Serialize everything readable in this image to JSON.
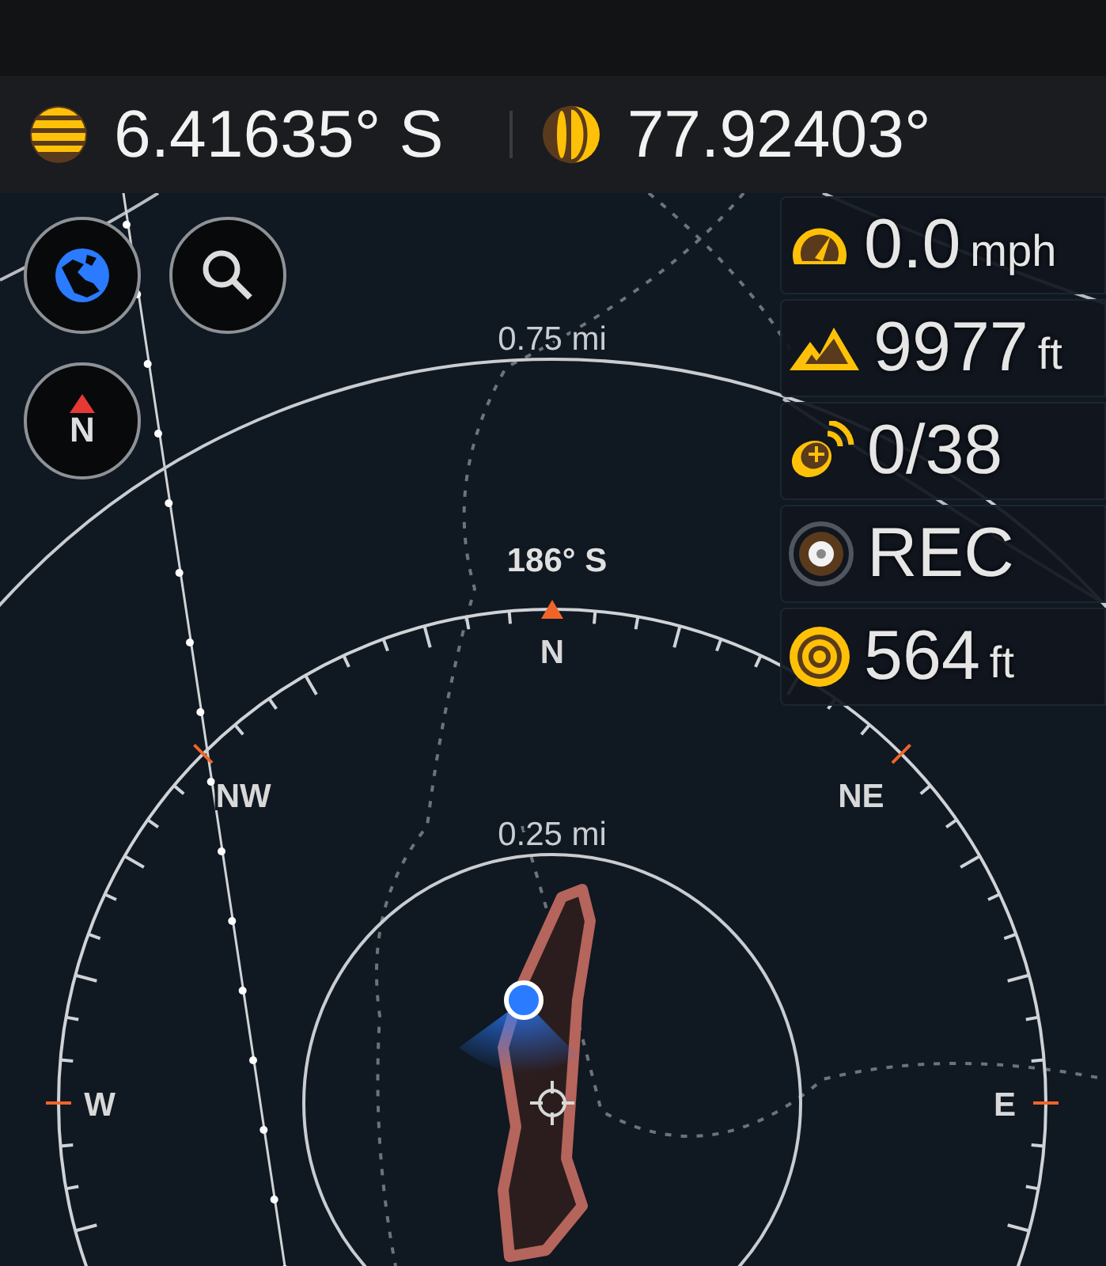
{
  "coordinates": [
    {
      "kind": "latitude",
      "value": "6.41635° S"
    },
    {
      "kind": "longitude",
      "value": "77.92403°"
    }
  ],
  "map_buttons": [
    {
      "kind": "layers"
    },
    {
      "kind": "search"
    },
    {
      "kind": "north",
      "label": "N"
    }
  ],
  "stats": [
    {
      "kind": "speed",
      "value": "0.0",
      "unit": "mph"
    },
    {
      "kind": "elevation",
      "value": "9977",
      "unit": "ft"
    },
    {
      "kind": "satellites",
      "value": "0/38"
    },
    {
      "kind": "recording",
      "value": "REC"
    },
    {
      "kind": "accuracy",
      "value": "564",
      "unit": "ft"
    }
  ],
  "compass": {
    "heading": "186° S",
    "directions": [
      {
        "kind": "north",
        "label": "N"
      },
      {
        "kind": "northeast",
        "label": "NE"
      },
      {
        "kind": "east",
        "label": "E"
      },
      {
        "kind": "west",
        "label": "W"
      },
      {
        "kind": "northwest",
        "label": "NW"
      }
    ],
    "rings": [
      {
        "kind": "outer",
        "label": "0.75 mi"
      },
      {
        "kind": "inner",
        "label": "0.25 mi"
      }
    ]
  }
}
